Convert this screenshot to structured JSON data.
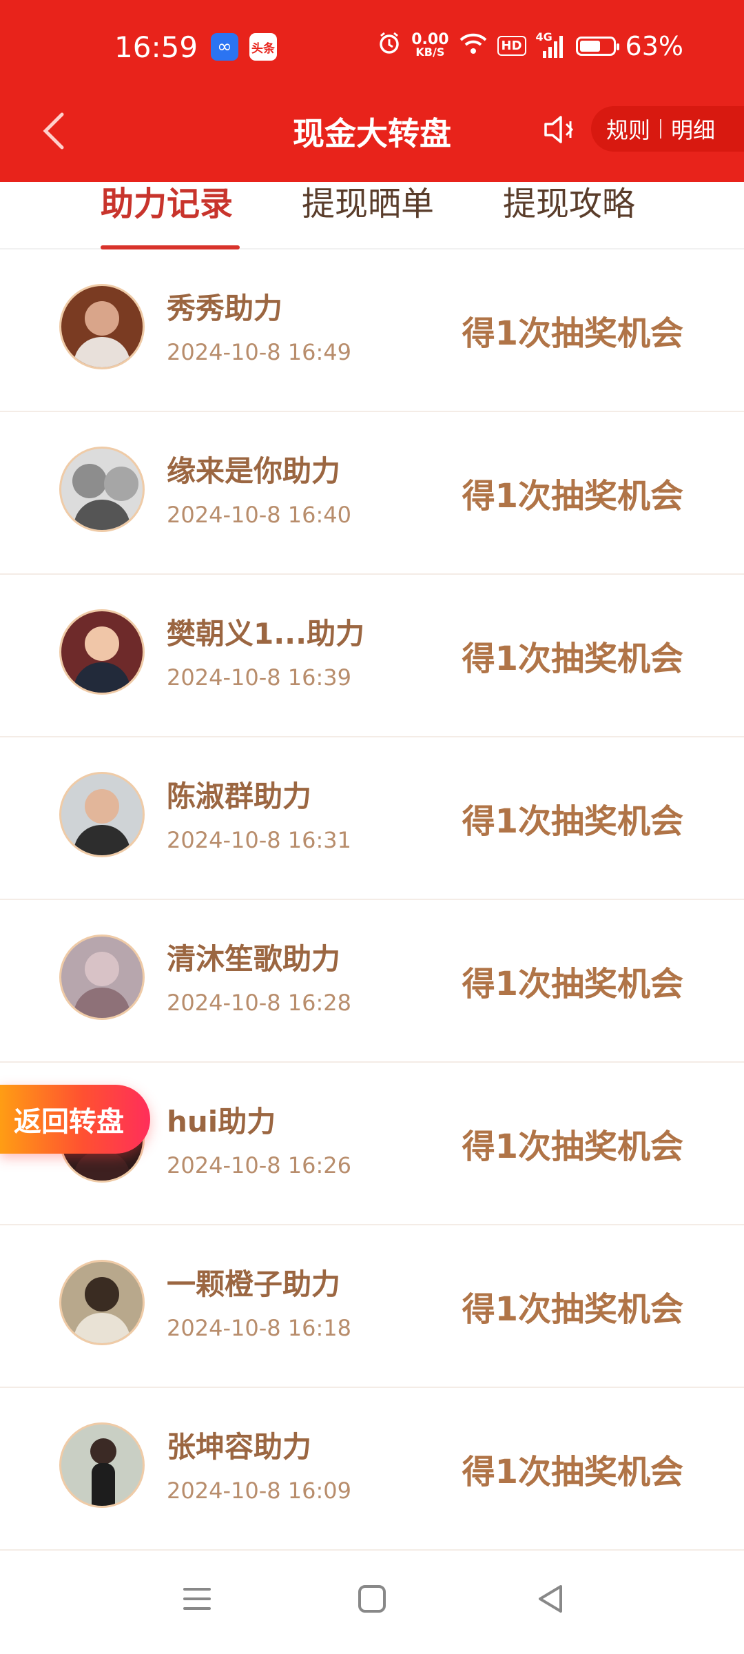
{
  "status_bar": {
    "time": "16:59",
    "app_badge_1_icon": "infinity-icon",
    "app_badge_2_text": "头条",
    "net_speed_value": "0.00",
    "net_speed_unit": "KB/S",
    "hd_label": "HD",
    "signal_label": "4G",
    "battery_percent": "63%",
    "battery_level": 0.63
  },
  "header": {
    "title": "现金大转盘",
    "rules_label": "规则",
    "details_label": "明细",
    "background_color": "#e8231b"
  },
  "tabs": [
    {
      "label": "助力记录",
      "active": true
    },
    {
      "label": "提现晒单",
      "active": false
    },
    {
      "label": "提现攻略",
      "active": false
    }
  ],
  "records": [
    {
      "name": "秀秀助力",
      "time": "2024-10-8 16:49",
      "reward": "得1次抽奖机会"
    },
    {
      "name": "缘来是你助力",
      "time": "2024-10-8 16:40",
      "reward": "得1次抽奖机会"
    },
    {
      "name": "樊朝义1...助力",
      "time": "2024-10-8 16:39",
      "reward": "得1次抽奖机会"
    },
    {
      "name": "陈淑群助力",
      "time": "2024-10-8 16:31",
      "reward": "得1次抽奖机会"
    },
    {
      "name": "清沐笙歌助力",
      "time": "2024-10-8 16:28",
      "reward": "得1次抽奖机会"
    },
    {
      "name": "hui助力",
      "time": "2024-10-8 16:26",
      "reward": "得1次抽奖机会"
    },
    {
      "name": "一颗橙子助力",
      "time": "2024-10-8 16:18",
      "reward": "得1次抽奖机会"
    },
    {
      "name": "张坤容助力",
      "time": "2024-10-8 16:09",
      "reward": "得1次抽奖机会"
    }
  ],
  "floating_button": {
    "label": "返回转盘"
  },
  "colors": {
    "accent_red": "#e8231b",
    "active_tab": "#c8342c",
    "name_text": "#9b6641",
    "reward_text": "#b07447"
  }
}
